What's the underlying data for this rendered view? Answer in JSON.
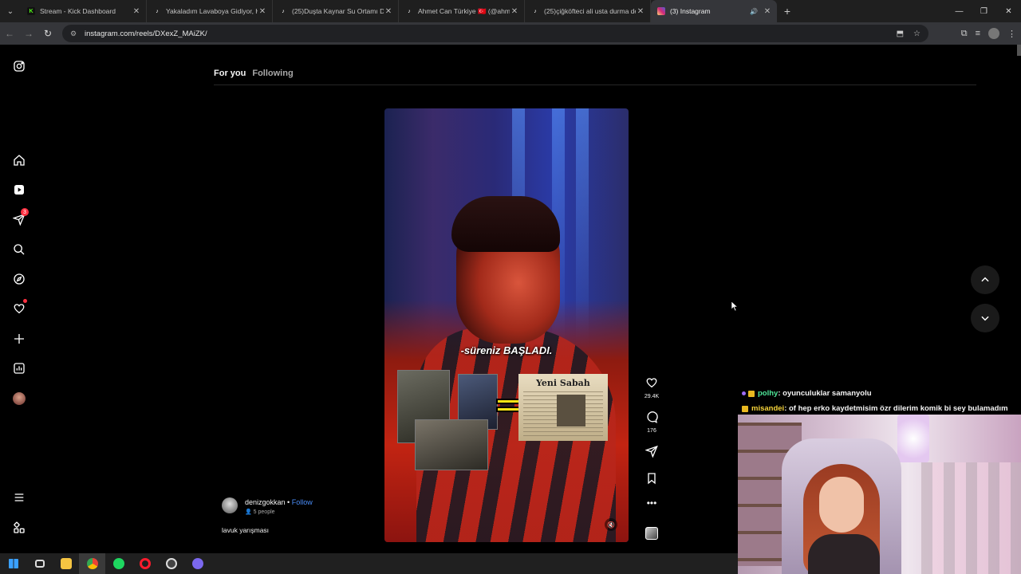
{
  "browser": {
    "tabs": [
      {
        "title": "Stream - Kick Dashboard",
        "favicon": "kick-icon",
        "color": "#53fc18",
        "active": false
      },
      {
        "title": "Yakaladım Lavaboya Gidiyor, H",
        "favicon": "tiktok-icon",
        "color": "#ffffff",
        "active": false
      },
      {
        "title": "(25)Duşta Kaynar Su Ortamı De",
        "favicon": "tiktok-icon",
        "color": "#ffffff",
        "active": false
      },
      {
        "title": "Ahmet Can Türkiye 🇹🇷 (@ahmet",
        "favicon": "tiktok-icon",
        "color": "#ffffff",
        "active": false
      },
      {
        "title": "(25)çiğköfteci ali usta durma de",
        "favicon": "tiktok-icon",
        "color": "#ffffff",
        "active": false
      },
      {
        "title": "(3) Instagram",
        "favicon": "instagram-icon",
        "color": "#e1306c",
        "active": true
      }
    ],
    "url": "instagram.com/reels/DXexZ_MAiZK/"
  },
  "feed": {
    "tab_for_you": "For you",
    "tab_following": "Following"
  },
  "sidebar": {
    "notification_count": "3"
  },
  "reel": {
    "subtitle": "-süreniz BAŞLADI.",
    "newspaper_title": "Yeni Sabah",
    "author": "denizgokkan",
    "separator": " • ",
    "follow_label": "Follow",
    "people": "5 people",
    "caption": "lavuk yarışması",
    "likes": "29.4K",
    "comments": "176"
  },
  "stream_chat": [
    {
      "user": "polhy",
      "user_color": "#4fe89a",
      "message": " : oyunculuklar samanyolu"
    },
    {
      "user": "misandei",
      "user_color": "#f5d33a",
      "message": " : of hep erko kaydetmisim özr dilerim komik bi sey bulamadım"
    }
  ],
  "colors": {
    "accent_follow": "#4a8df8",
    "notification_red": "#ff3040"
  }
}
